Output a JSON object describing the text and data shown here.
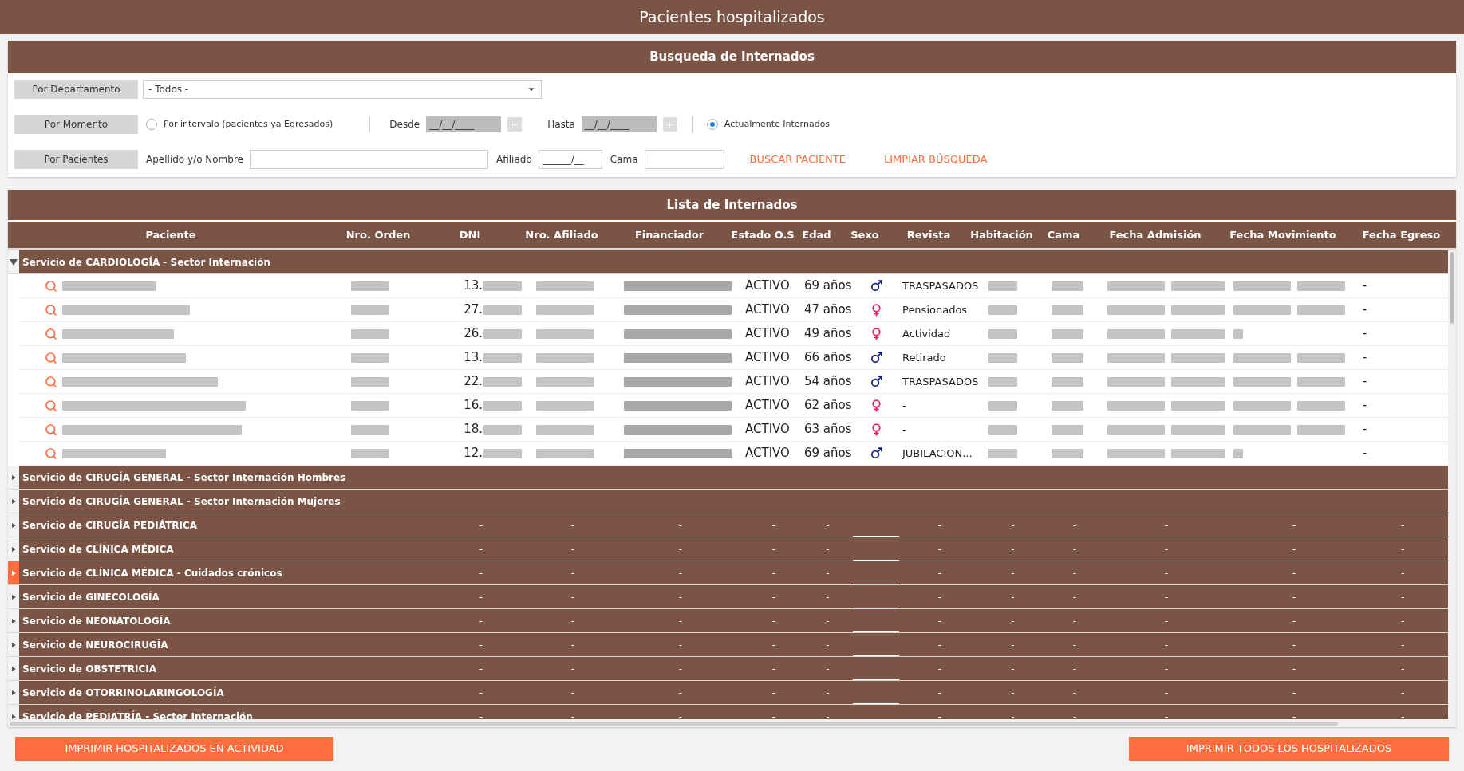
{
  "title": "Pacientes hospitalizados",
  "search": {
    "title": "Busqueda de Internados",
    "departamento": {
      "label": "Por Departamento",
      "value": "- Todos -"
    },
    "momento": {
      "label": "Por Momento",
      "intervalo": {
        "label": "Por intervalo (pacientes ya Egresados)",
        "selected": false
      },
      "desde": {
        "label": "Desde",
        "value": "__/__/____"
      },
      "hasta": {
        "label": "Hasta",
        "value": "__/__/____"
      },
      "actual": {
        "label": "Actualmente Internados",
        "selected": true
      }
    },
    "pacientes": {
      "label": "Por Pacientes",
      "nombre_label": "Apellido y/o Nombre",
      "afiliado_label": "Afiliado",
      "afiliado_value": "______/__",
      "cama_label": "Cama"
    },
    "actions": [
      "BUSCAR PACIENTE",
      "LIMPIAR BÚSQUEDA"
    ]
  },
  "list": {
    "title": "Lista de Internados",
    "columns": [
      "Paciente",
      "Nro. Orden",
      "DNI",
      "Nro. Afiliado",
      "Financiador",
      "Estado O.S",
      "Edad",
      "Sexo",
      "Revista",
      "Habitación",
      "Cama",
      "Fecha Admisión",
      "Fecha Movimiento",
      "Fecha Egreso"
    ],
    "groups": [
      {
        "name": "Servicio de CARDIOLOGÍA - Sector Internación",
        "expanded": true,
        "selected": false,
        "rows": [
          {
            "dni": "13.",
            "estado": "ACTIVO",
            "edad": "69 años",
            "kind": "male",
            "revista": "TRASPASADOS",
            "fecha_egreso": "-"
          },
          {
            "dni": "27.",
            "estado": "ACTIVO",
            "edad": "47 años",
            "kind": "female",
            "revista": "Pensionados",
            "fecha_egreso": "-"
          },
          {
            "dni": "26.",
            "estado": "ACTIVO",
            "edad": "49 años",
            "kind": "female",
            "revista": "Actividad",
            "fecha_egreso": "-"
          },
          {
            "dni": "13.",
            "estado": "ACTIVO",
            "edad": "66 años",
            "kind": "male",
            "revista": "Retirado",
            "fecha_egreso": "-"
          },
          {
            "dni": "22.",
            "estado": "ACTIVO",
            "edad": "54 años",
            "kind": "male",
            "revista": "TRASPASADOS",
            "fecha_egreso": "-"
          },
          {
            "dni": "16.",
            "estado": "ACTIVO",
            "edad": "62 años",
            "kind": "female",
            "revista": "-",
            "fecha_egreso": "-"
          },
          {
            "dni": "18.",
            "estado": "ACTIVO",
            "edad": "63 años",
            "kind": "female",
            "revista": "-",
            "fecha_egreso": "-"
          },
          {
            "dni": "12.",
            "estado": "ACTIVO",
            "edad": "69 años",
            "kind": "male",
            "revista": "JUBILACION...",
            "fecha_egreso": "-"
          }
        ]
      },
      {
        "name": "Servicio de CIRUGÍA GENERAL - Sector Internación Hombres",
        "expanded": false,
        "selected": false
      },
      {
        "name": "Servicio de CIRUGÍA GENERAL - Sector Internación Mujeres",
        "expanded": false,
        "selected": false
      },
      {
        "name": "Servicio de CIRUGÍA PEDIÁTRICA",
        "expanded": false,
        "selected": false,
        "cells": [
          null,
          null,
          "-",
          "-",
          "-",
          "-",
          "-",
          null,
          "-",
          "-",
          "-",
          "-",
          "-",
          "-"
        ]
      },
      {
        "name": "Servicio de CLÍNICA MÉDICA",
        "expanded": false,
        "selected": false,
        "cells": [
          null,
          null,
          "-",
          "-",
          "-",
          "-",
          "-",
          null,
          "-",
          "-",
          "-",
          "-",
          "-",
          "-"
        ]
      },
      {
        "name": "Servicio de CLÍNICA MÉDICA - Cuidados crónicos",
        "expanded": false,
        "selected": true,
        "cells": [
          null,
          null,
          "-",
          "-",
          "-",
          "-",
          "-",
          null,
          "-",
          "-",
          "-",
          "-",
          "-",
          "-"
        ]
      },
      {
        "name": "Servicio de GINECOLOGÍA",
        "expanded": false,
        "selected": false,
        "cells": [
          null,
          null,
          "-",
          "-",
          "-",
          "-",
          "-",
          null,
          "-",
          "-",
          "-",
          "-",
          "-",
          "-"
        ]
      },
      {
        "name": "Servicio de NEONATOLOGÍA",
        "expanded": false,
        "selected": false,
        "cells": [
          null,
          null,
          "-",
          "-",
          "-",
          "-",
          "-",
          null,
          "-",
          "-",
          "-",
          "-",
          "-",
          "-"
        ]
      },
      {
        "name": "Servicio de NEUROCIRUGÍA",
        "expanded": false,
        "selected": false,
        "cells": [
          null,
          null,
          "-",
          "-",
          "-",
          "-",
          "-",
          null,
          "-",
          "-",
          "-",
          "-",
          "-",
          "-"
        ]
      },
      {
        "name": "Servicio de OBSTETRICIA",
        "expanded": false,
        "selected": false,
        "cells": [
          null,
          null,
          "-",
          "-",
          "-",
          "-",
          "-",
          null,
          "-",
          "-",
          "-",
          "-",
          "-",
          "-"
        ]
      },
      {
        "name": "Servicio de OTORRINOLARINGOLOGÍA",
        "expanded": false,
        "selected": false,
        "cells": [
          null,
          null,
          "-",
          "-",
          "-",
          "-",
          "-",
          null,
          "-",
          "-",
          "-",
          "-",
          "-",
          "-"
        ]
      },
      {
        "name": "Servicio de PEDIATRÍA - Sector Internación",
        "expanded": false,
        "selected": false,
        "cells": [
          null,
          null,
          "-",
          "-",
          "-",
          "-",
          "-",
          null,
          "-",
          "-",
          "-",
          "-",
          "-",
          "-"
        ]
      }
    ]
  },
  "footer_buttons": [
    "IMPRIMIR HOSPITALIZADOS EN ACTIVIDAD",
    "IMPRIMIR TODOS LOS HOSPITALIZADOS"
  ]
}
